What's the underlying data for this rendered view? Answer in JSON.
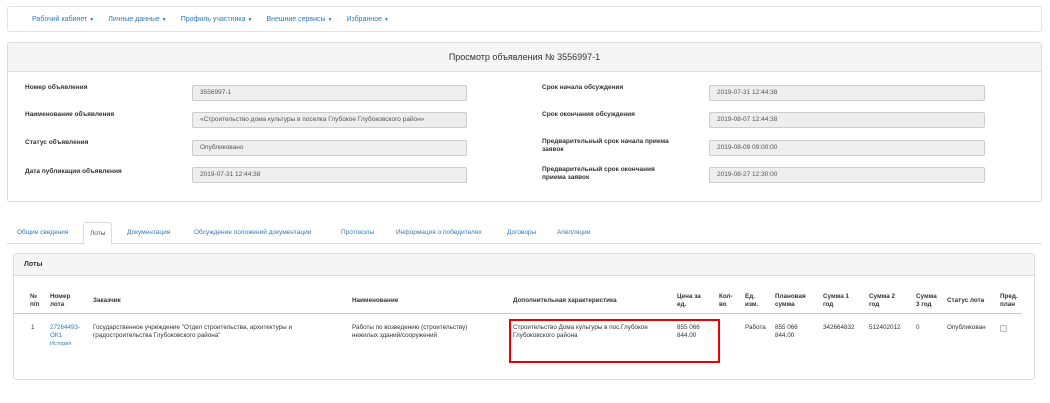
{
  "navbar": {
    "items": [
      {
        "label": "Рабочий кабинет"
      },
      {
        "label": "Личные данные"
      },
      {
        "label": "Профиль участника"
      },
      {
        "label": "Внешние сервисы"
      },
      {
        "label": "Избранное"
      }
    ]
  },
  "panel": {
    "title": "Просмотр объявления № 3556997-1",
    "fields": {
      "number": {
        "label": "Номер объявления",
        "value": "3556997-1"
      },
      "name": {
        "label": "Наименование объявления",
        "value": "«Строительство дома культуры в поселка Глубокое Глубоковского район»"
      },
      "status": {
        "label": "Статус объявления",
        "value": "Опубликовано"
      },
      "pub_date": {
        "label": "Дата публикации объявления",
        "value": "2019-07-31 12:44:38"
      },
      "disc_start": {
        "label": "Срок начала обсуждения",
        "value": "2019-07-31 12:44:38"
      },
      "disc_end": {
        "label": "Срок окончания обсуждения",
        "value": "2019-08-07 12:44:38"
      },
      "pre_start": {
        "label_1": "Предварительный срок начала приема",
        "label_2": "заявок",
        "value": "2019-08-09 09:00:00"
      },
      "pre_end": {
        "label_1": "Предварительный срок окончания",
        "label_2": "приема заявок",
        "value": "2019-08-27 12:30:00"
      }
    }
  },
  "tabs": [
    {
      "label": "Общие сведения"
    },
    {
      "label": "Лоты"
    },
    {
      "label": "Документация"
    },
    {
      "label": "Обсуждение положений документации"
    },
    {
      "label": "Протоколы"
    },
    {
      "label": "Информация о победителях"
    },
    {
      "label": "Договоры"
    },
    {
      "label": "Апелляции"
    }
  ],
  "active_tab": "Лоты",
  "lots": {
    "heading": "Лоты",
    "columns": {
      "num_1": "№",
      "num_2": "п/п",
      "lot_1": "Номер",
      "lot_2": "лота",
      "customer": "Заказчик",
      "name": "Наименование",
      "extra": "Дополнительная характеристика",
      "price_1": "Цена за",
      "price_2": "ед.",
      "qty_1": "Кол-",
      "qty_2": "во",
      "unit_1": "Ед.",
      "unit_2": "изм.",
      "planned_1": "Плановая",
      "planned_2": "сумма",
      "sum1_1": "Сумма 1",
      "sum1_2": "год",
      "sum2_1": "Сумма 2",
      "sum2_2": "год",
      "sum3_1": "Сумма",
      "sum3_2": "3 год",
      "status": "Статус лота",
      "plan_1": "Пред.",
      "plan_2": "план"
    },
    "rows": [
      {
        "num": "1",
        "lot_1": "27264493-",
        "lot_2": "ОК1",
        "history": "История",
        "customer_1": "Государственное учреждение \"Отдел строительства, архитектуры и",
        "customer_2": "градостроительства Глубоковского района\"",
        "name_1": "Работы по возведению (строительству)",
        "name_2": "нежилых зданий/сооружений",
        "extra_1": "Строительство Дома культуры в пос.Глубокое",
        "extra_2": "Глубоковского района",
        "price_1": "855 066",
        "price_2": "844.00",
        "qty": "",
        "unit": "Работа",
        "planned_1": "855 066",
        "planned_2": "844.00",
        "sum1": "342664832",
        "sum2": "512402012",
        "sum3": "0",
        "status": "Опубликован"
      }
    ]
  },
  "colors": {
    "link": "#337ab7",
    "highlight": "#e00000"
  }
}
